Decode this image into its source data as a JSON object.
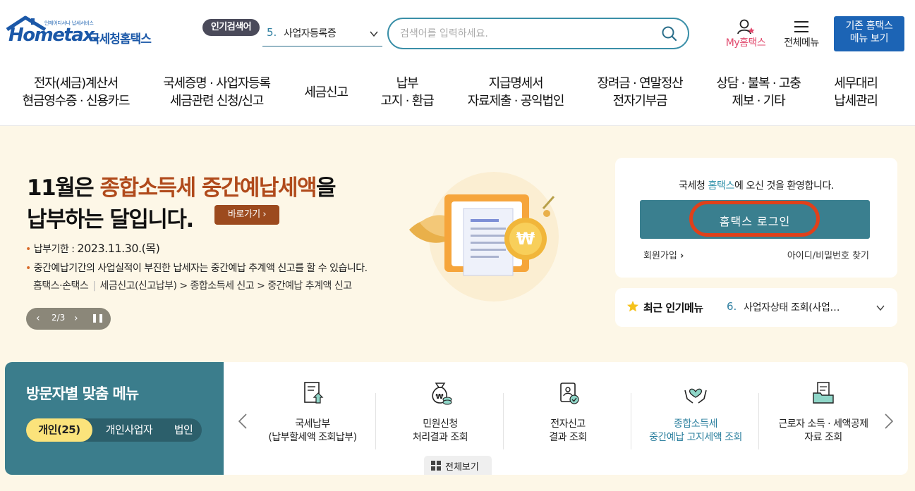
{
  "header": {
    "logo_small": "언제어디서나 납세서비스",
    "logo_main": "Hometax.",
    "logo_name": "국세청홈택스",
    "popular_badge": "인기검색어",
    "popular_num": "5.",
    "popular_term": "사업자등록증",
    "search_placeholder": "검색어를 입력하세요.",
    "my_hometax": "My홈택스",
    "all_menu": "전체메뉴",
    "legacy_line1": "기존 홈택스",
    "legacy_line2": "메뉴 보기"
  },
  "gnb": [
    {
      "line1": "전자(세금)계산서",
      "line2": "현금영수증 · 신용카드"
    },
    {
      "line1": "국세증명 · 사업자등록",
      "line2": "세금관련 신청/신고"
    },
    {
      "line1": "세금신고",
      "line2": ""
    },
    {
      "line1": "납부",
      "line2": "고지 · 환급"
    },
    {
      "line1": "지급명세서",
      "line2": "자료제출 · 공익법인"
    },
    {
      "line1": "장려금 · 연말정산",
      "line2": "전자기부금"
    },
    {
      "line1": "상담 · 불복 · 고충",
      "line2": "제보 · 기타"
    },
    {
      "line1": "세무대리",
      "line2": "납세관리"
    }
  ],
  "hero": {
    "title_pre": "11월은 ",
    "title_highlight": "종합소득세 중간예납세액",
    "title_post": "을",
    "title_line2": "납부하는 달입니다.",
    "go_button": "바로가기",
    "deadline_label": "납부기한 : ",
    "deadline_value": "2023.11.30.(목)",
    "notice": "중간예납기간의 사업실적이 부진한 납세자는 중간예납 추계액 신고를 할 수 있습니다.",
    "path_a": "홈택스·손택스",
    "path_b": "세금신고(신고납부) > 종합소득세 신고 > 중간예납 추계액 신고",
    "slide_count": "2/3"
  },
  "login": {
    "welcome_pre": "국세청 ",
    "welcome_hl": "홈택스",
    "welcome_post": "에 오신 것을 환영합니다.",
    "login_button": "홈택스 로그인",
    "join": "회원가입",
    "find": "아이디/비밀번호 찾기"
  },
  "recent": {
    "title": "최근 인기메뉴",
    "num": "6.",
    "item": "사업자상태 조회(사업…"
  },
  "visitor": {
    "title": "방문자별 맞춤 메뉴",
    "tabs": [
      "개인(25)",
      "개인사업자",
      "법인"
    ],
    "active_tab": 0
  },
  "quick_menu": [
    {
      "icon": "tax-payment-icon",
      "line1": "국세납부",
      "line2": "(납부할세액 조회납부)"
    },
    {
      "icon": "money-bag-icon",
      "line1": "민원신청",
      "line2": "처리결과 조회"
    },
    {
      "icon": "e-filing-icon",
      "line1": "전자신고",
      "line2": "결과 조회"
    },
    {
      "icon": "heart-hands-icon",
      "line1": "종합소득세",
      "line2": "중간예납 고지세액 조회"
    },
    {
      "icon": "folder-icon",
      "line1": "근로자 소득 · 세액공제",
      "line2": "자료 조회"
    }
  ],
  "view_all": "전체보기",
  "colors": {
    "brand_blue": "#1b58a8",
    "teal": "#3a7f8f",
    "highlight_orange": "#b04a1b",
    "login_ring": "#e0401a",
    "hero_bg": "#fdf7e7"
  }
}
